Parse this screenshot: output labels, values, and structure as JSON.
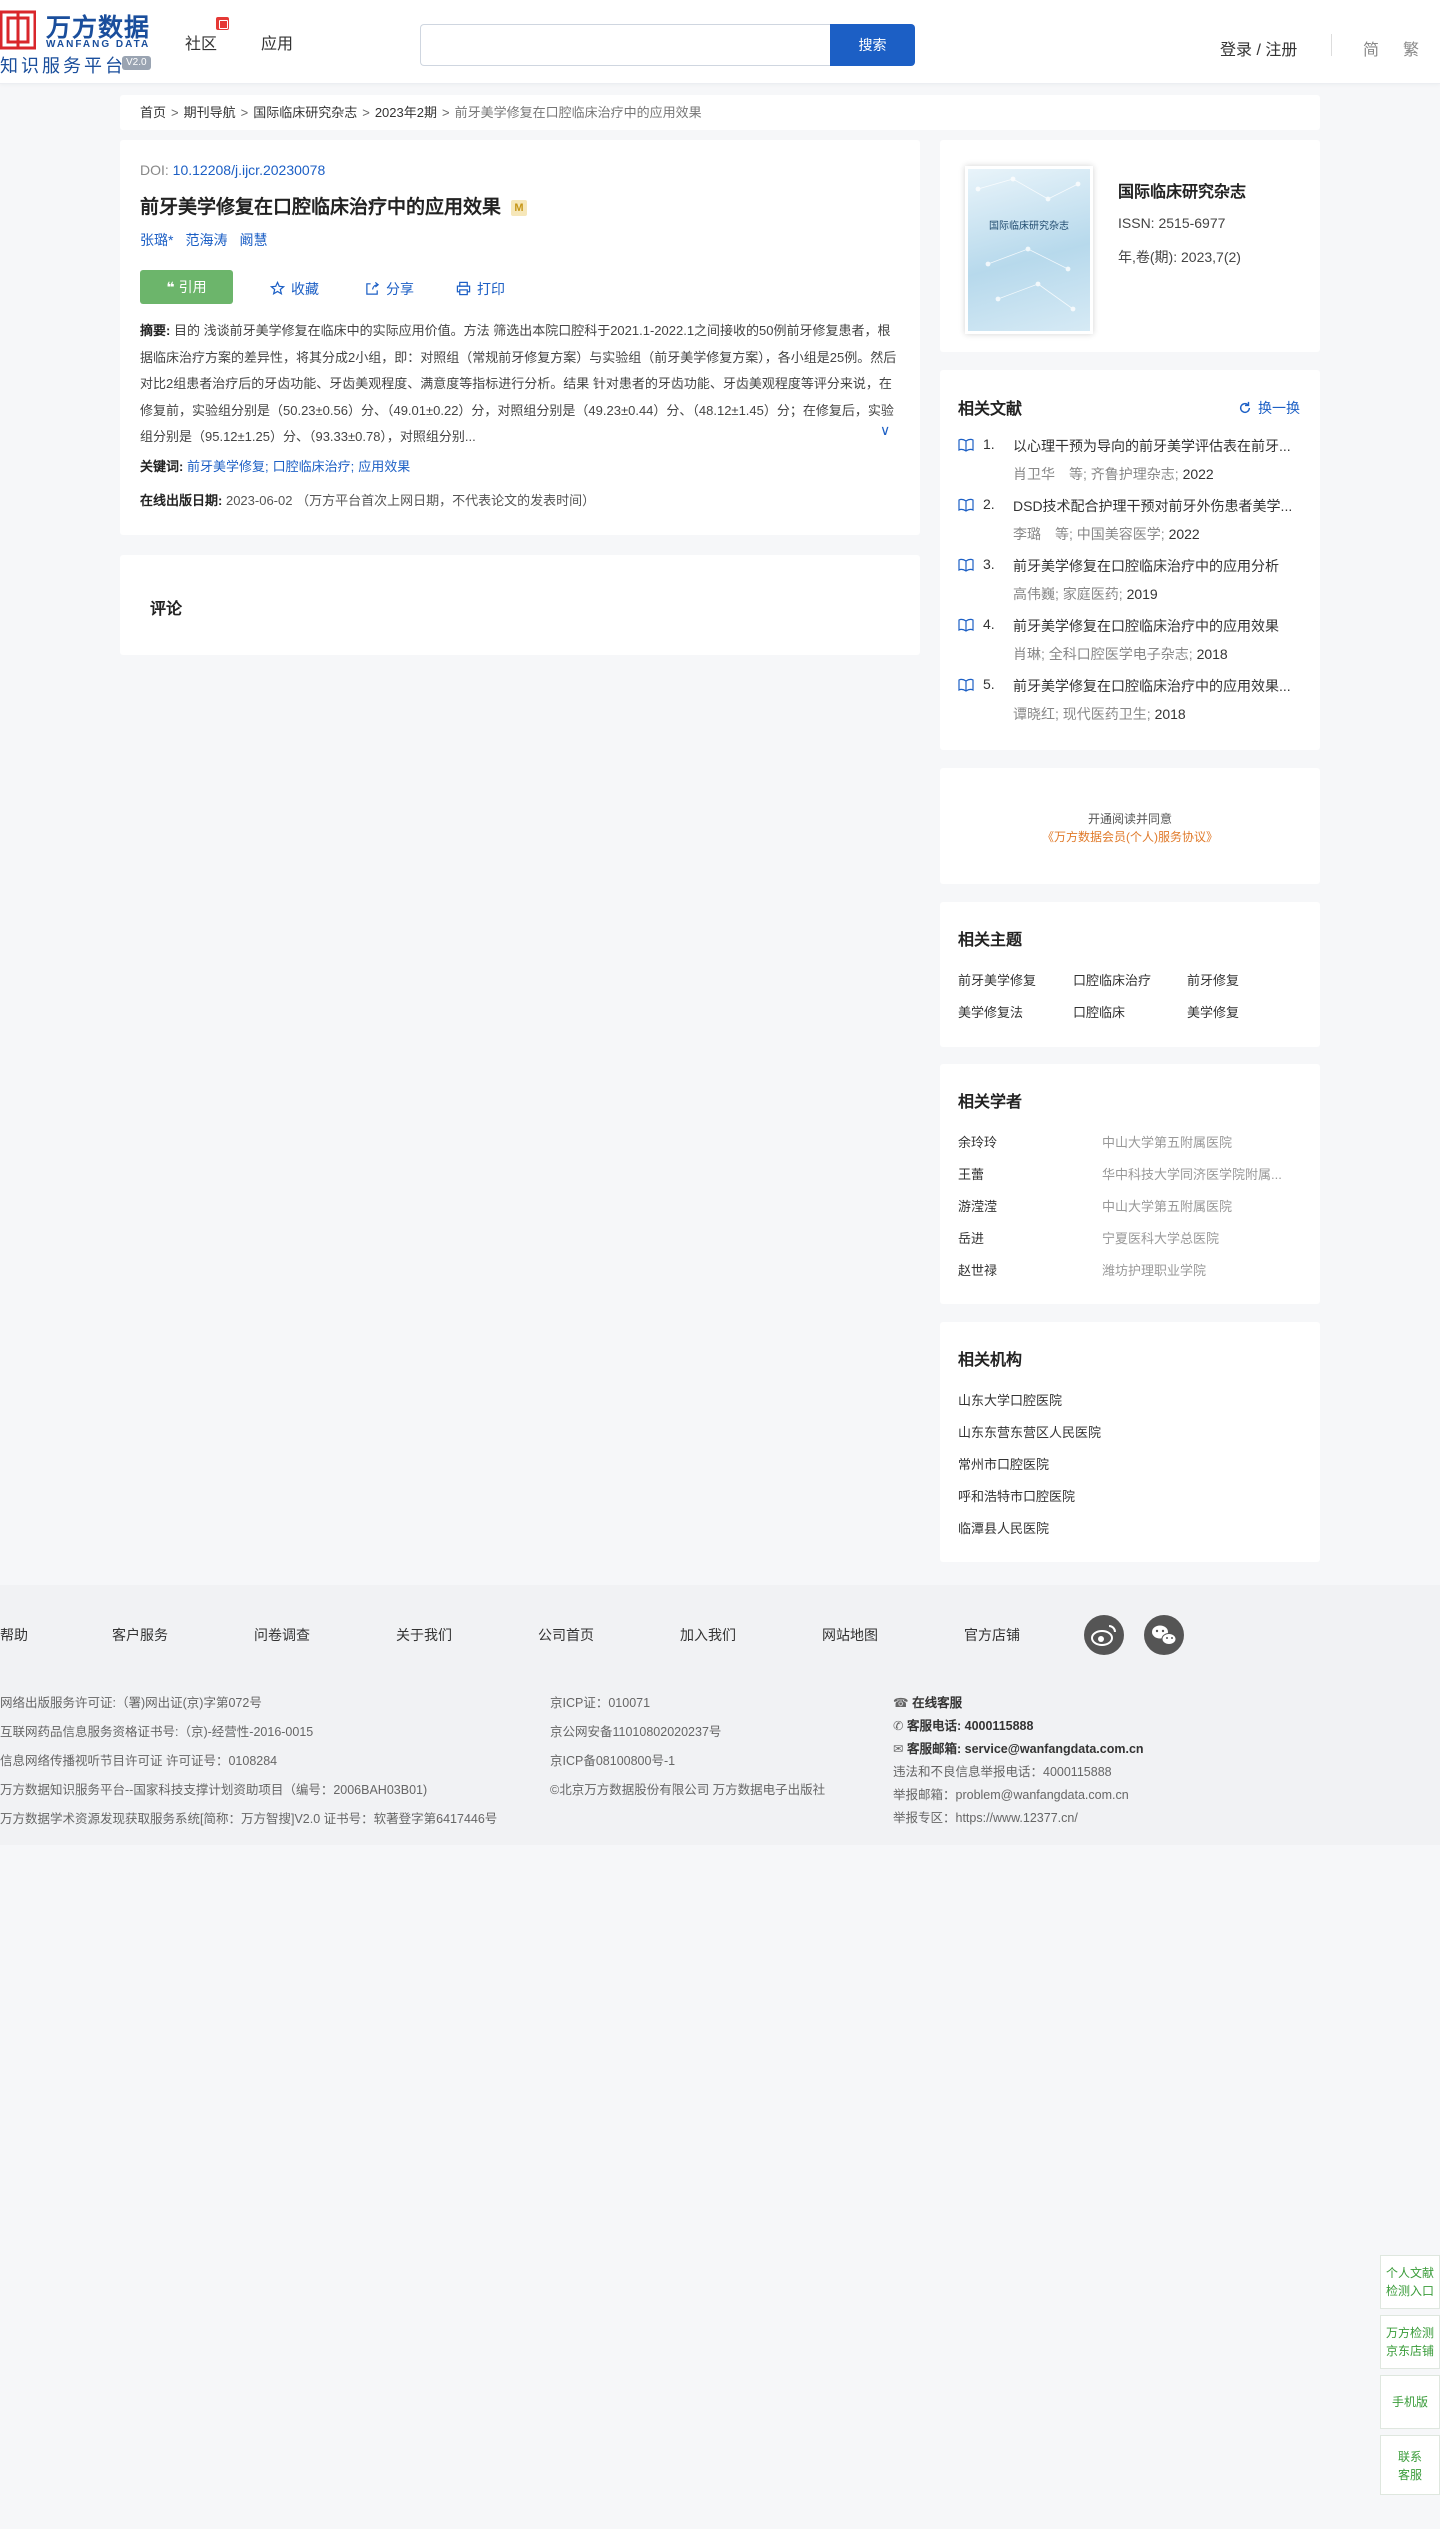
{
  "header": {
    "logo_cn": "万方数据",
    "logo_en": "WANFANG DATA",
    "logo_sub": "知识服务平台",
    "logo_version": "V2.0",
    "nav_community": "社区",
    "nav_apps": "应用",
    "search_placeholder": "",
    "search_button": "搜索",
    "login": "登录 / 注册",
    "lang_simplified": "简",
    "lang_traditional": "繁"
  },
  "breadcrumb": [
    "首页",
    "期刊导航",
    "国际临床研究杂志",
    "2023年2期",
    "前牙美学修复在口腔临床治疗中的应用效果"
  ],
  "breadcrumb_sep": ">",
  "article": {
    "doi_label": "DOI: ",
    "doi_value": "10.12208/j.ijcr.20230078",
    "title": "前牙美学修复在口腔临床治疗中的应用效果",
    "title_badge": "M",
    "authors": [
      "张璐*",
      "范海涛",
      "阚慧"
    ],
    "cite_label": "引用",
    "collect_label": "收藏",
    "share_label": "分享",
    "print_label": "打印",
    "abstract_label": "摘要:",
    "abstract_text": "目的 浅谈前牙美学修复在临床中的实际应用价值。方法 筛选出本院口腔科于2021.1-2022.1之间接收的50例前牙修复患者，根据临床治疗方案的差异性，将其分成2小组，即：对照组（常规前牙修复方案）与实验组（前牙美学修复方案），各小组是25例。然后对比2组患者治疗后的牙齿功能、牙齿美观程度、满意度等指标进行分析。结果 针对患者的牙齿功能、牙齿美观程度等评分来说，在修复前，实验组分别是（50.23±0.56）分、（49.01±0.22）分，对照组分别是（49.23±0.44）分、（48.12±1.45）分；在修复后，实验组分别是（95.12±1.25）分、（93.33±0.78），对照组分别...",
    "keywords_label": "关键词:",
    "keywords": [
      "前牙美学修复;",
      "口腔临床治疗;",
      "应用效果"
    ],
    "pubdate_label": "在线出版日期:",
    "pubdate_value": "2023-06-02  （万方平台首次上网日期，不代表论文的发表时间）"
  },
  "comment": {
    "title": "评论"
  },
  "journal": {
    "cover_text": "国际临床研究杂志",
    "name": "国际临床研究杂志",
    "issn": "ISSN:  2515-6977",
    "volume": "年,卷(期):  2023,7(2)"
  },
  "related_literature": {
    "title": "相关文献",
    "refresh": "换一换",
    "items": [
      {
        "num": "1.",
        "title": "以心理干预为导向的前牙美学评估表在前牙...",
        "meta": "肖卫华　等;  齐鲁护理杂志;",
        "year": "2022"
      },
      {
        "num": "2.",
        "title": "DSD技术配合护理干预对前牙外伤患者美学...",
        "meta": "李璐　等;  中国美容医学;",
        "year": "2022"
      },
      {
        "num": "3.",
        "title": "前牙美学修复在口腔临床治疗中的应用分析",
        "meta": "高伟巍;  家庭医药;",
        "year": "2019"
      },
      {
        "num": "4.",
        "title": "前牙美学修复在口腔临床治疗中的应用效果",
        "meta": "肖琳;  全科口腔医学电子杂志;",
        "year": "2018"
      },
      {
        "num": "5.",
        "title": "前牙美学修复在口腔临床治疗中的应用效果...",
        "meta": "谭晓红;  现代医药卫生;",
        "year": "2018"
      }
    ]
  },
  "agreement": {
    "line1": "开通阅读并同意",
    "line2": "《万方数据会员(个人)服务协议》"
  },
  "related_topics": {
    "title": "相关主题",
    "items": [
      "前牙美学修复",
      "口腔临床治疗",
      "前牙修复",
      "美学修复法",
      "口腔临床",
      "美学修复"
    ]
  },
  "related_scholars": {
    "title": "相关学者",
    "items": [
      {
        "name": "余玲玲",
        "org": "中山大学第五附属医院"
      },
      {
        "name": "王蕾",
        "org": "华中科技大学同济医学院附属..."
      },
      {
        "name": "游滢滢",
        "org": "中山大学第五附属医院"
      },
      {
        "name": "岳进",
        "org": "宁夏医科大学总医院"
      },
      {
        "name": "赵世禄",
        "org": "潍坊护理职业学院"
      }
    ]
  },
  "related_orgs": {
    "title": "相关机构",
    "items": [
      "山东大学口腔医院",
      "山东东营东营区人民医院",
      "常州市口腔医院",
      "呼和浩特市口腔医院",
      "临潭县人民医院"
    ]
  },
  "footer": {
    "nav": [
      "帮助",
      "客户服务",
      "问卷调查",
      "关于我们",
      "公司首页",
      "加入我们",
      "网站地图",
      "官方店铺"
    ],
    "col1": [
      "网络出版服务许可证:（署)网出证(京)字第072号",
      "互联网药品信息服务资格证书号:（京)-经营性-2016-0015",
      "信息网络传播视听节目许可证 许可证号：0108284",
      "万方数据知识服务平台--国家科技支撑计划资助项目（编号：2006BAH03B01)",
      "万方数据学术资源发现获取服务系统[简称：万方智搜]V2.0 证书号：软著登字第6417446号"
    ],
    "col2": [
      "京ICP证：010071",
      "京公网安备11010802020237号",
      "京ICP备08100800号-1",
      "©北京万方数据股份有限公司 万方数据电子出版社"
    ],
    "online_service": "在线客服",
    "phone_label": "客服电话:",
    "phone_value": "4000115888",
    "email_label": "客服邮箱:",
    "email_value": "service@wanfangdata.com.cn",
    "report_phone": "违法和不良信息举报电话：4000115888",
    "report_email": "举报邮箱：problem@wanfangdata.com.cn",
    "report_zone": "举报专区：https://www.12377.cn/"
  },
  "side_float": [
    {
      "l1": "个人文献",
      "l2": "检测入口"
    },
    {
      "l1": "万方检测",
      "l2": "京东店铺"
    },
    {
      "l1": "手机版",
      "l2": ""
    },
    {
      "l1": "联系",
      "l2": "客服"
    }
  ],
  "colors": {
    "brand": "#1a4e9c",
    "accent": "#1c5fc5",
    "cite": "#6cb56b",
    "agreement": "#e07a2a"
  }
}
